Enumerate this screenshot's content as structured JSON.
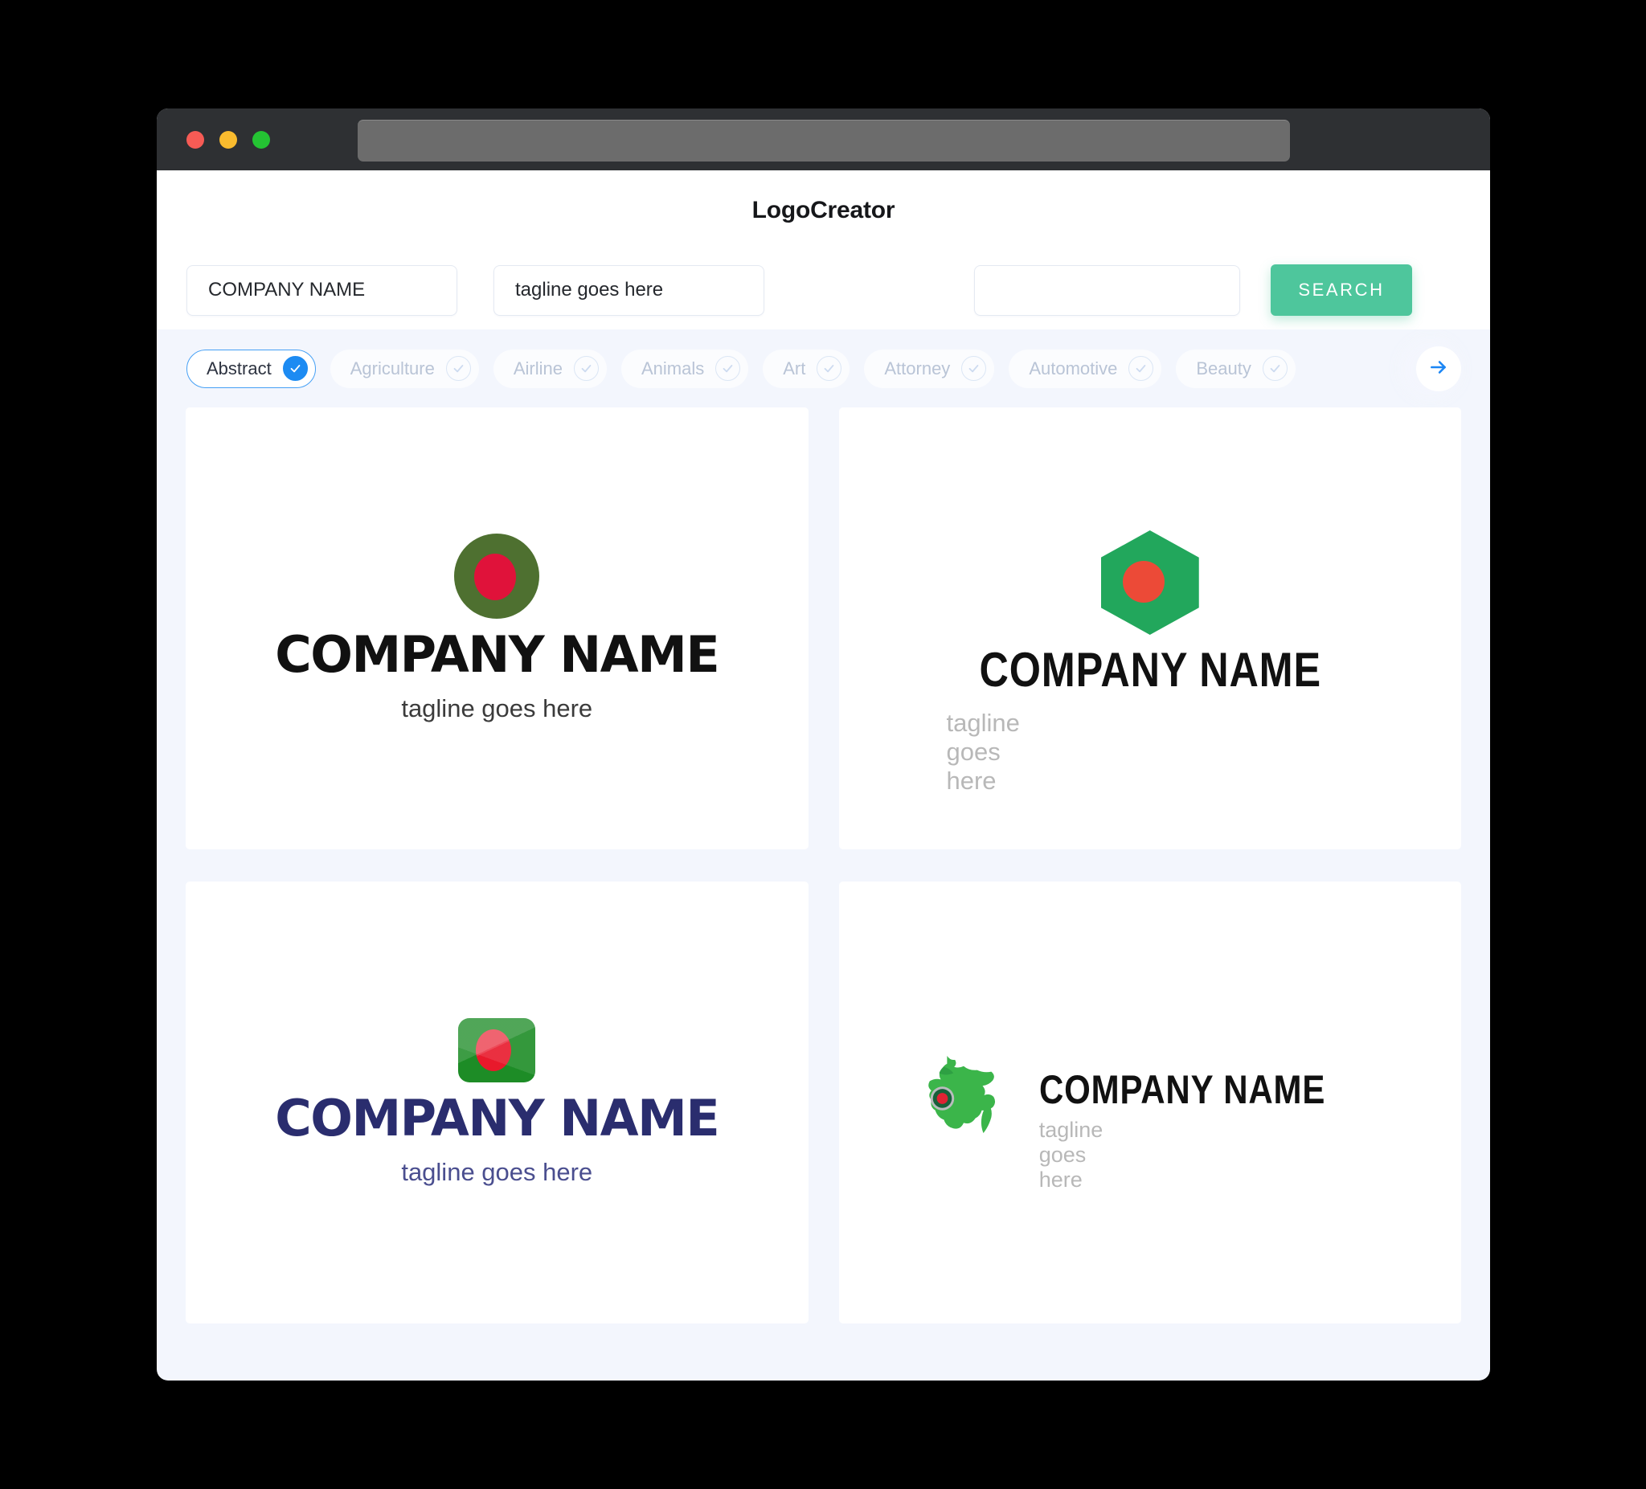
{
  "window": {
    "traffic_lights": [
      "close",
      "minimize",
      "maximize"
    ],
    "address_bar_value": ""
  },
  "header": {
    "title": "LogoCreator"
  },
  "search": {
    "company_value": "COMPANY NAME",
    "company_placeholder": "COMPANY NAME",
    "tagline_value": "tagline goes here",
    "tagline_placeholder": "tagline goes here",
    "extra_value": "",
    "extra_placeholder": "",
    "search_label": "SEARCH",
    "search_button_color": "#4ec69c"
  },
  "categories": {
    "next_icon": "arrow-right-icon",
    "active_color": "#1d8bf2",
    "items": [
      {
        "label": "Abstract",
        "active": true
      },
      {
        "label": "Agriculture",
        "active": false
      },
      {
        "label": "Airline",
        "active": false
      },
      {
        "label": "Animals",
        "active": false
      },
      {
        "label": "Art",
        "active": false
      },
      {
        "label": "Attorney",
        "active": false
      },
      {
        "label": "Automotive",
        "active": false
      },
      {
        "label": "Beauty",
        "active": false
      }
    ]
  },
  "logos": [
    {
      "mark": "green-circle-red-dot-icon",
      "name": "COMPANY NAME",
      "tagline": "tagline goes here",
      "name_color": "#111111",
      "tagline_color": "#3b3b3b"
    },
    {
      "mark": "green-hexagon-red-dot-icon",
      "name": "COMPANY NAME",
      "tagline": "tagline goes here",
      "name_color": "#111111",
      "tagline_color": "#b8b8b8"
    },
    {
      "mark": "green-flag-red-dot-icon",
      "name": "COMPANY NAME",
      "tagline": "tagline goes here",
      "name_color": "#2a2d6e",
      "tagline_color": "#4a4e8f"
    },
    {
      "mark": "green-map-pin-icon",
      "name": "COMPANY NAME",
      "tagline": "tagline goes here",
      "name_color": "#111111",
      "tagline_color": "#b8b8b8"
    }
  ]
}
